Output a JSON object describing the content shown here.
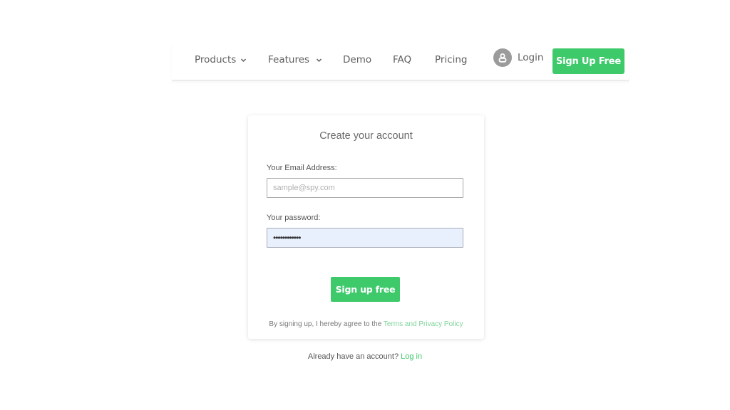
{
  "nav": {
    "items": [
      {
        "label": "Products",
        "has_dropdown": true
      },
      {
        "label": "Features",
        "has_dropdown": true
      },
      {
        "label": "Demo",
        "has_dropdown": false
      },
      {
        "label": "FAQ",
        "has_dropdown": false
      },
      {
        "label": "Pricing",
        "has_dropdown": false
      }
    ],
    "login": {
      "label": "Login",
      "icon": "user-circle-icon"
    },
    "signup_button": "Sign Up Free"
  },
  "form": {
    "title": "Create your account",
    "email": {
      "label": "Your Email Address:",
      "placeholder": "sample@spy.com",
      "value": ""
    },
    "password": {
      "label": "Your password:",
      "value": "••••••••••••"
    },
    "submit_label": "Sign up free",
    "terms_prefix": "By signing up, I hereby agree to the ",
    "terms_link": "Terms and Privacy Policy"
  },
  "footer": {
    "prompt": "Already have an account? ",
    "login_link": "Log in"
  },
  "colors": {
    "accent": "#3ec96b",
    "link_light": "#7ed39a",
    "autofill_bg": "#e8f0fe",
    "text": "#5f5f5f"
  }
}
